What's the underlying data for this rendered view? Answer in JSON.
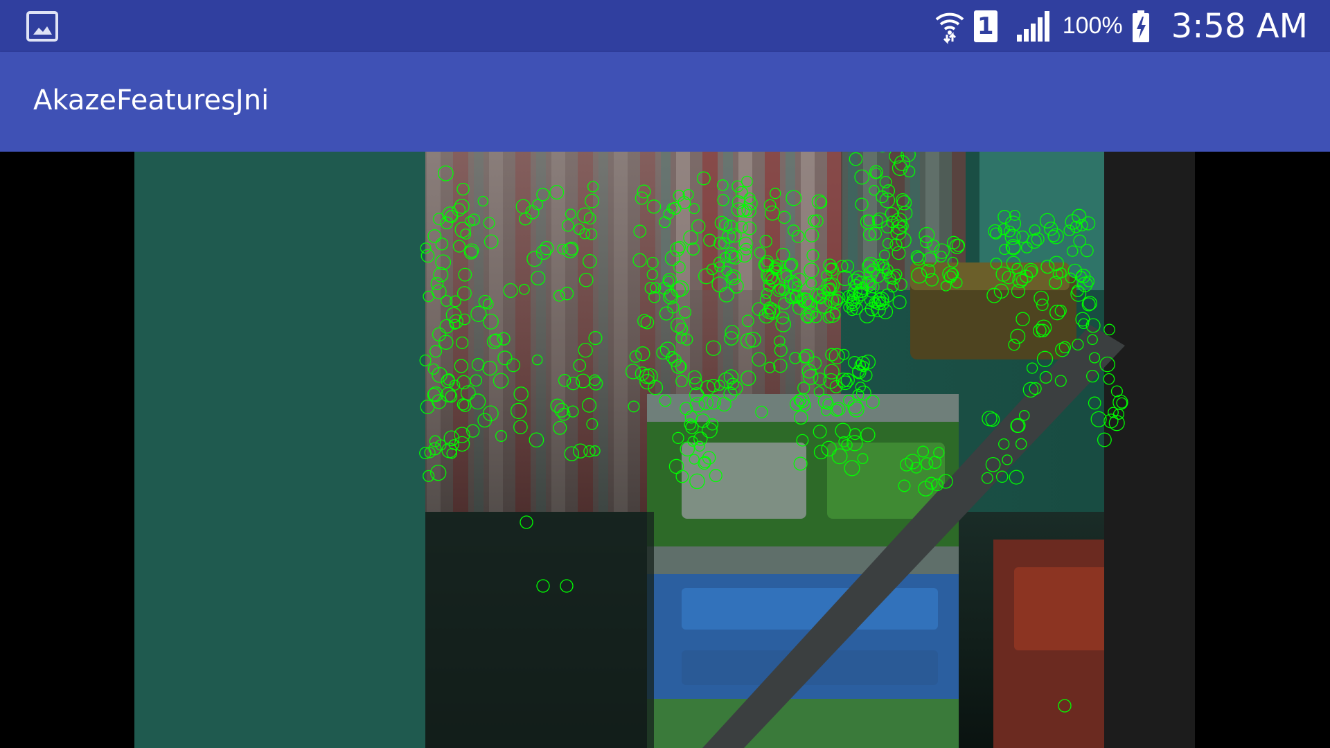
{
  "status_bar": {
    "notification_icon": "image-icon",
    "wifi_icon": "wifi-data-icon",
    "sim_label": "1",
    "signal_icon": "cell-signal-icon",
    "battery_percent": "100%",
    "battery_icon": "battery-charging-icon",
    "time": "3:58 AM",
    "color": "#303f9f"
  },
  "app_bar": {
    "title": "AkazeFeaturesJni",
    "color": "#3f51b5"
  },
  "camera_view": {
    "description_keypoint_color": "#00ff00"
  }
}
